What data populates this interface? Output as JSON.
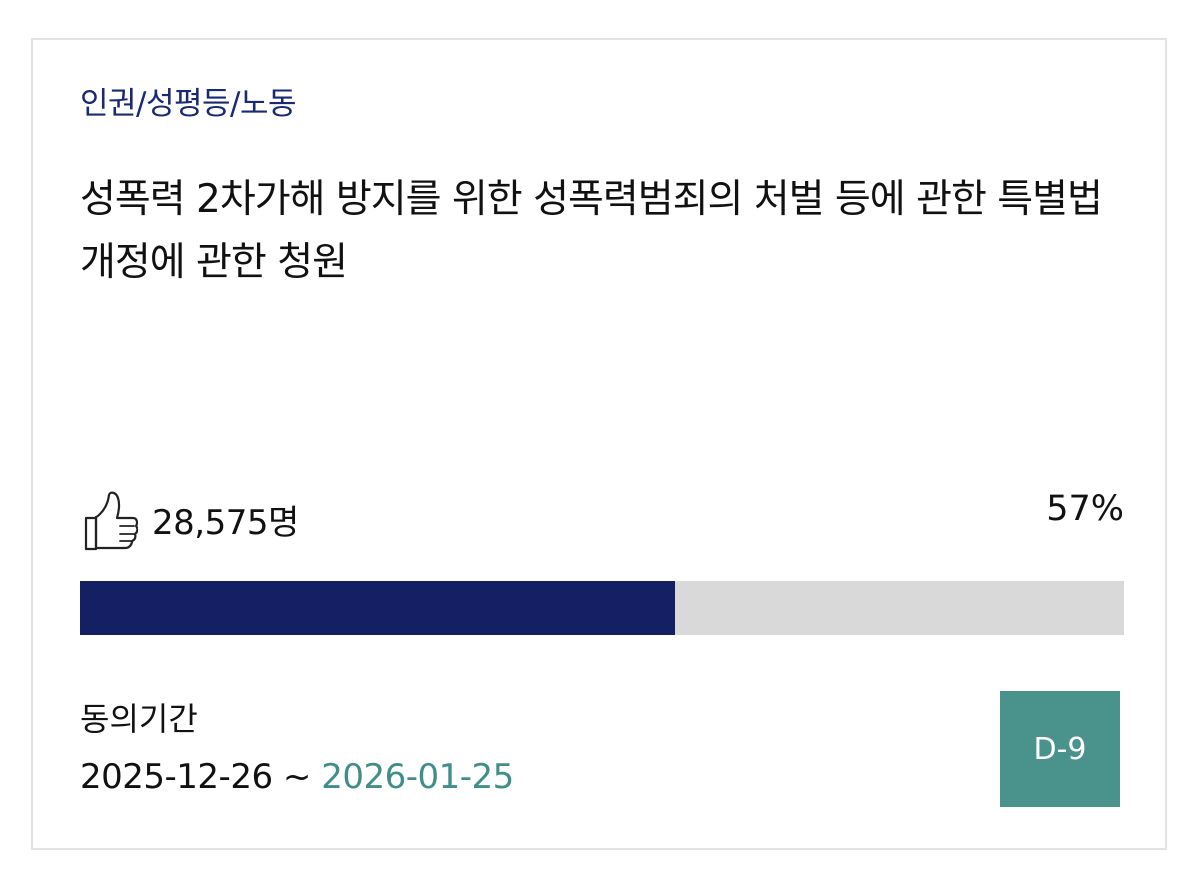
{
  "petition": {
    "category": "인권/성평등/노동",
    "title": "성폭력 2차가해 방지를 위한 성폭력범죄의 처벌 등에 관한 특별법 개정에 관한 청원",
    "agree_count": "28,575명",
    "progress_label": "57%",
    "progress_value": 57,
    "period_label": "동의기간",
    "period_start": "2025-12-26",
    "period_separator": " ~ ",
    "period_end": "2026-01-25",
    "dday": "D-9"
  },
  "icons": {
    "agree": "thumbs-up-icon"
  },
  "colors": {
    "category": "#1a2a72",
    "progress_fill": "#141f64",
    "progress_track": "#d9d9d9",
    "period_end": "#3f8e88",
    "dday_bg": "#4a928c"
  }
}
